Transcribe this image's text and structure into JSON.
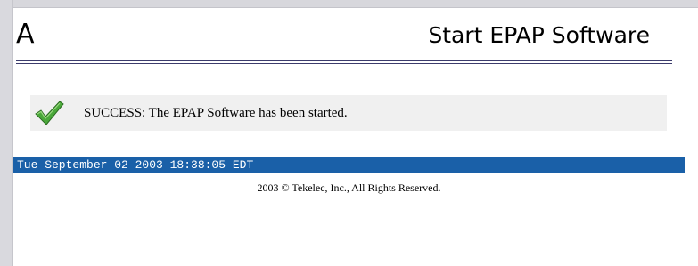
{
  "header": {
    "letter": "A",
    "title": "Start EPAP Software"
  },
  "message": {
    "icon": "checkmark-icon",
    "text": "SUCCESS: The EPAP Software has been started."
  },
  "footer": {
    "timestamp": "Tue September 02 2003 18:38:05 EDT",
    "copyright": "2003 © Tekelec, Inc., All Rights Reserved."
  },
  "colors": {
    "timestamp_bar": "#1a60a8",
    "success_box": "#f0f0f0",
    "checkmark": "#3a9a2a",
    "rule": "#3c3c6c"
  }
}
